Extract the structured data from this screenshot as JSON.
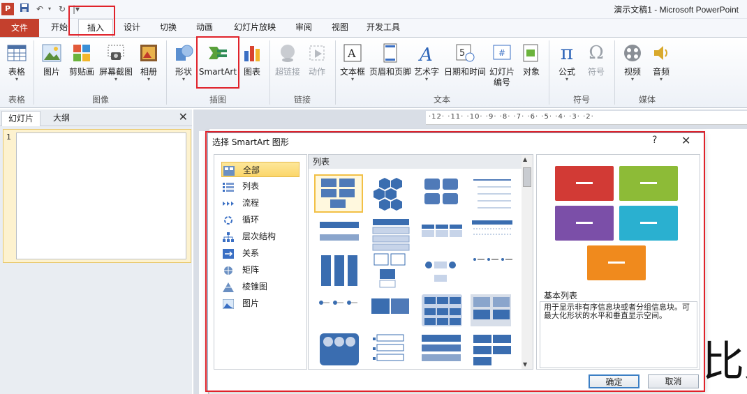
{
  "window": {
    "title": "演示文稿1 - Microsoft PowerPoint"
  },
  "tabs": [
    {
      "label": "文件"
    },
    {
      "label": "开始"
    },
    {
      "label": "插入"
    },
    {
      "label": "设计"
    },
    {
      "label": "切换"
    },
    {
      "label": "动画"
    },
    {
      "label": "幻灯片放映"
    },
    {
      "label": "审阅"
    },
    {
      "label": "视图"
    },
    {
      "label": "开发工具"
    }
  ],
  "ribbon": {
    "buttons": [
      {
        "label": "表格",
        "icon": "table-icon"
      },
      {
        "label": "图片",
        "icon": "picture-icon"
      },
      {
        "label": "剪贴画",
        "icon": "clipart-icon"
      },
      {
        "label": "屏幕截图",
        "icon": "screenshot-icon"
      },
      {
        "label": "相册",
        "icon": "album-icon"
      },
      {
        "label": "形状",
        "icon": "shapes-icon"
      },
      {
        "label": "SmartArt",
        "icon": "smartart-icon"
      },
      {
        "label": "图表",
        "icon": "chart-icon"
      },
      {
        "label": "超链接",
        "icon": "hyperlink-icon"
      },
      {
        "label": "动作",
        "icon": "action-icon"
      },
      {
        "label": "文本框",
        "icon": "textbox-icon"
      },
      {
        "label": "页眉和页脚",
        "icon": "header-footer-icon"
      },
      {
        "label": "艺术字",
        "icon": "wordart-icon"
      },
      {
        "label": "日期和时间",
        "icon": "datetime-icon"
      },
      {
        "label": "幻灯片",
        "label2": "编号",
        "icon": "slide-number-icon"
      },
      {
        "label": "对象",
        "icon": "object-icon"
      },
      {
        "label": "公式",
        "icon": "equation-icon"
      },
      {
        "label": "符号",
        "icon": "symbol-icon"
      },
      {
        "label": "视频",
        "icon": "video-icon"
      },
      {
        "label": "音频",
        "icon": "audio-icon"
      }
    ],
    "groups": [
      "表格",
      "图像",
      "插图",
      "链接",
      "文本",
      "符号",
      "媒体"
    ]
  },
  "left_pane": {
    "tabs": [
      "幻灯片",
      "大纲"
    ],
    "slide_number": "1"
  },
  "ruler": {
    "labels": "·12·  ·11·  ·10·  ·9·  ·8·  ·7·  ·6·  ·5·  ·4·  ·3·  ·2·"
  },
  "dialog": {
    "title": "选择 SmartArt 图形",
    "help": "?",
    "close": "✕",
    "categories": [
      "全部",
      "列表",
      "流程",
      "循环",
      "层次结构",
      "关系",
      "矩阵",
      "棱锥图",
      "图片"
    ],
    "selected_category": "全部",
    "grid_header": "列表",
    "preview_name": "基本列表",
    "preview_description": "用于显示非有序信息块或者分组信息块。可最大化形状的水平和垂直显示空间。",
    "ok_label": "确定",
    "cancel_label": "取消",
    "preview_colors": [
      "#d23a35",
      "#8dbb37",
      "#7b4fa8",
      "#2ab0d0",
      "#f08a1d"
    ]
  },
  "slide_text_fragment": "比允"
}
